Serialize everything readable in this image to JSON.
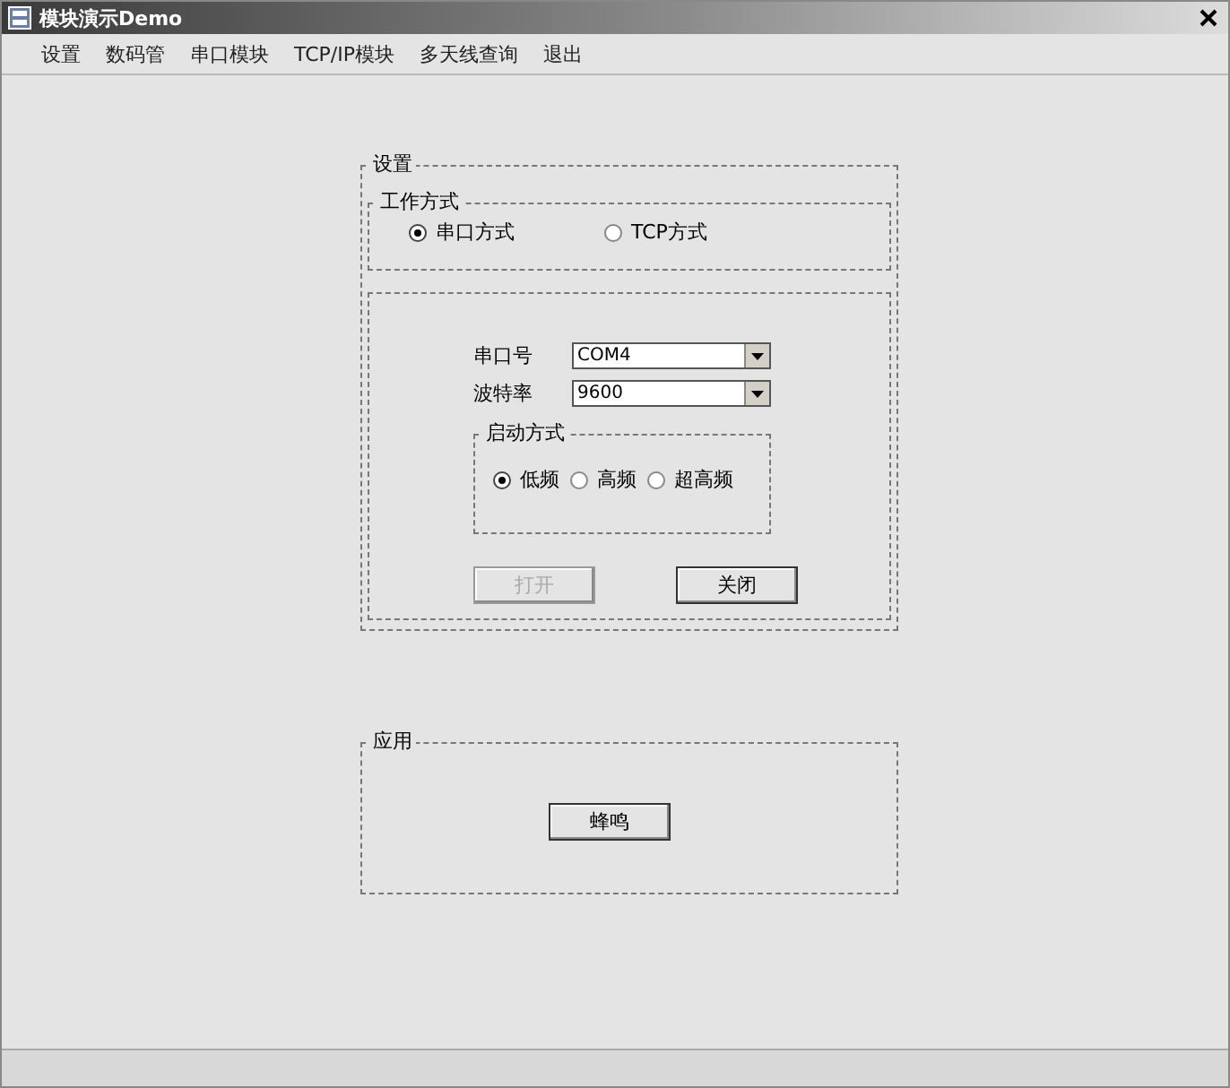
{
  "window": {
    "title": "模块演示Demo"
  },
  "menu": [
    {
      "label": "设置"
    },
    {
      "label": "数码管"
    },
    {
      "label": "串口模块"
    },
    {
      "label": "TCP/IP模块"
    },
    {
      "label": "多天线查询"
    },
    {
      "label": "退出"
    }
  ],
  "settings_group": {
    "title": "设置",
    "mode_group": {
      "title": "工作方式",
      "options": [
        {
          "label": "串口方式",
          "selected": true
        },
        {
          "label": "TCP方式",
          "selected": false
        }
      ]
    },
    "fields": [
      {
        "label": "串口号",
        "value": "COM4"
      },
      {
        "label": "波特率",
        "value": "9600"
      }
    ],
    "start_group": {
      "title": "启动方式",
      "options": [
        {
          "label": "低频",
          "selected": true
        },
        {
          "label": "高频",
          "selected": false
        },
        {
          "label": "超高频",
          "selected": false
        }
      ]
    },
    "buttons": [
      {
        "label": "打开",
        "disabled": true
      },
      {
        "label": "关闭",
        "disabled": false
      }
    ]
  },
  "apply_group": {
    "title": "应用",
    "buttons": [
      {
        "label": "蜂鸣",
        "disabled": false
      }
    ]
  }
}
